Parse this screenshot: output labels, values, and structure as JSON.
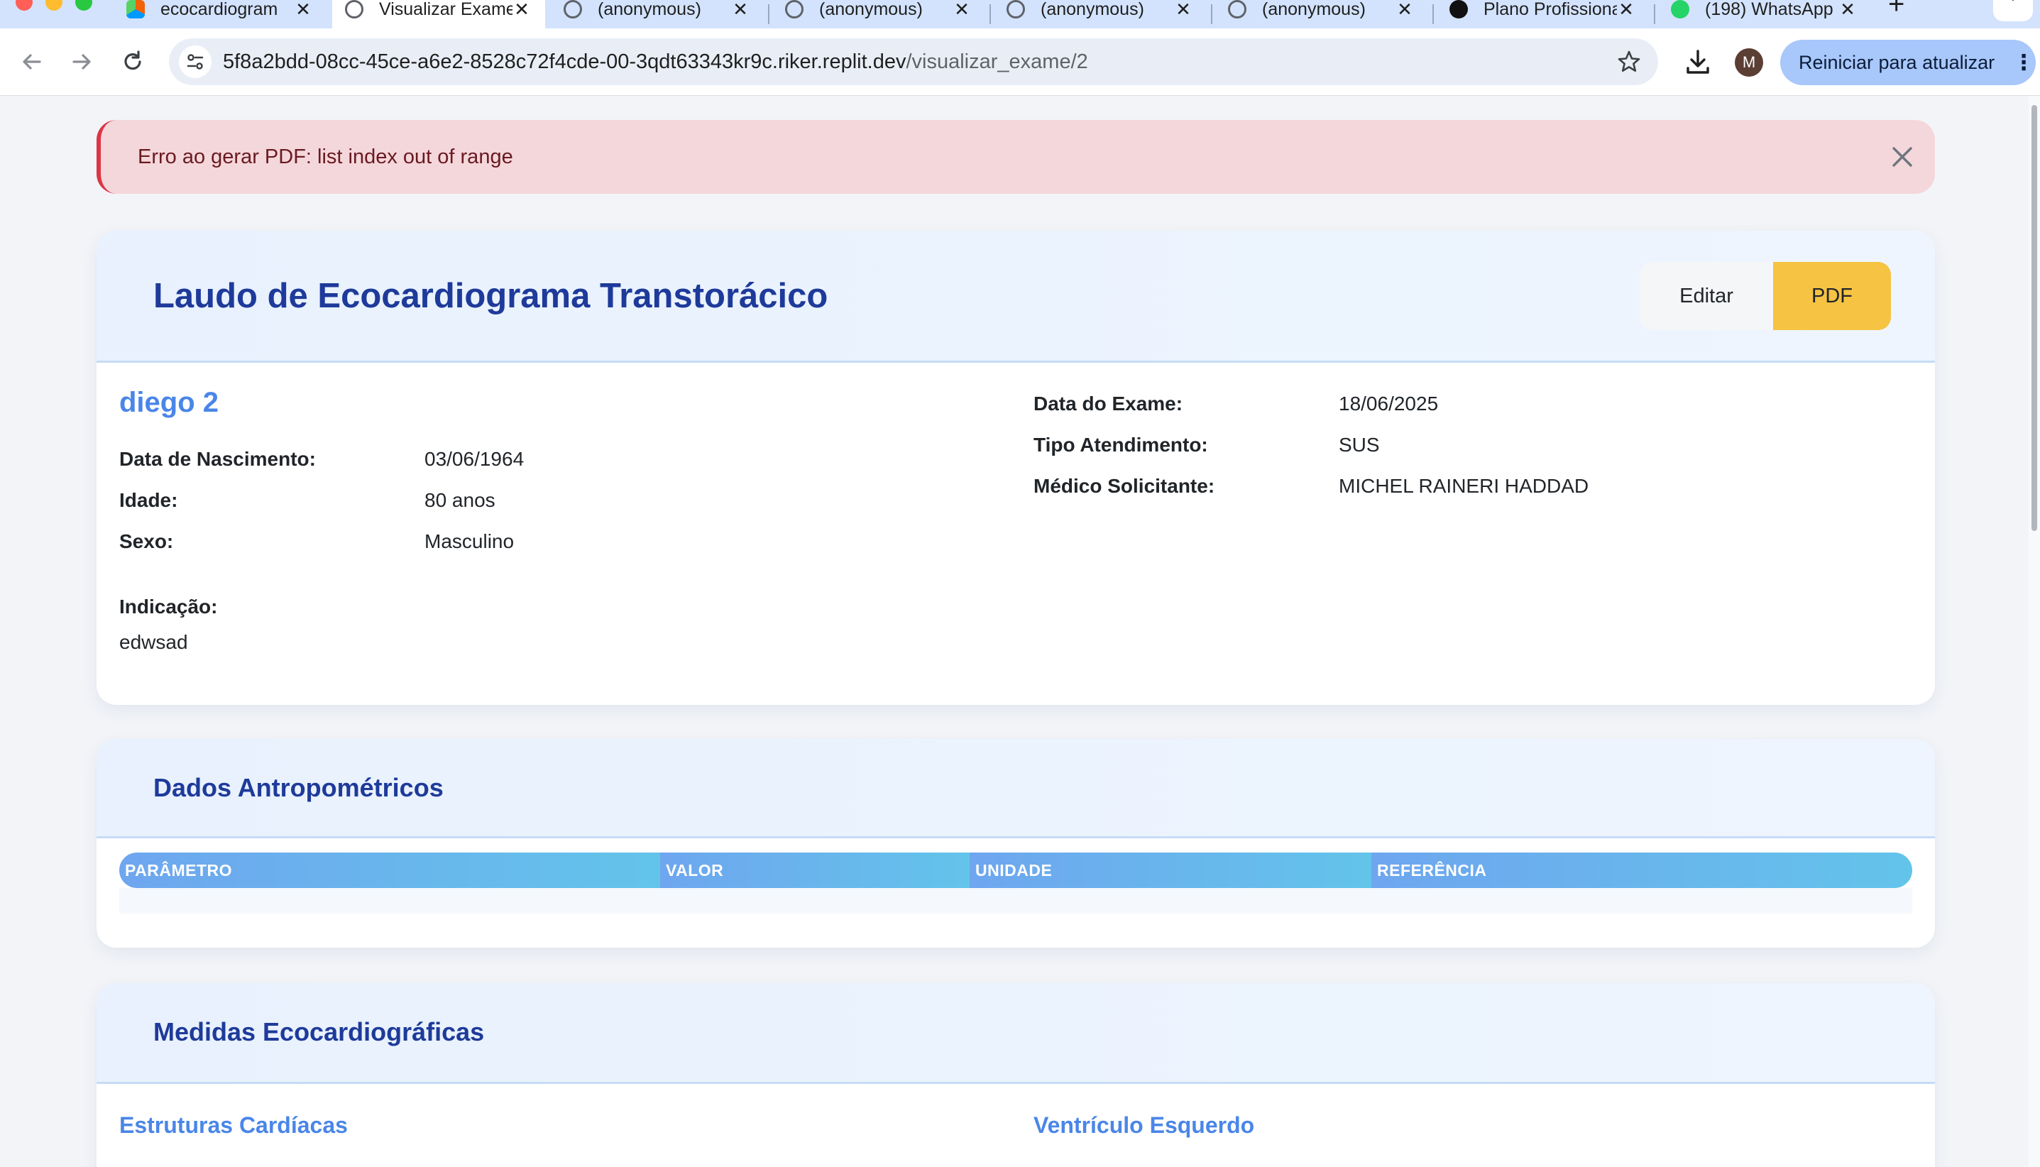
{
  "browser": {
    "tabs": [
      {
        "title": "ecocardiogram",
        "active": false
      },
      {
        "title": "Visualizar Exame",
        "active": true
      },
      {
        "title": "(anonymous)",
        "active": false
      },
      {
        "title": "(anonymous)",
        "active": false
      },
      {
        "title": "(anonymous)",
        "active": false
      },
      {
        "title": "(anonymous)",
        "active": false
      },
      {
        "title": "Plano Profissional",
        "active": false
      },
      {
        "title": "(198) WhatsApp",
        "active": false
      }
    ],
    "new_tab_symbol": "+",
    "url_host": "5f8a2bdd-08cc-45ce-a6e2-8528c72f4cde-00-3qdt63343kr9c.riker.replit.dev",
    "url_path": "/visualizar_exame/2",
    "profile_initial": "M",
    "update_button": "Reiniciar para atualizar"
  },
  "alert": {
    "message": "Erro ao gerar PDF: list index out of range"
  },
  "report": {
    "title": "Laudo de Ecocardiograma Transtorácico",
    "edit_label": "Editar",
    "pdf_label": "PDF",
    "patient_name": "diego 2",
    "birth_label": "Data de Nascimento:",
    "birth_value": "03/06/1964",
    "age_label": "Idade:",
    "age_value": "80 anos",
    "sex_label": "Sexo:",
    "sex_value": "Masculino",
    "indication_label": "Indicação:",
    "indication_value": "edwsad",
    "exam_date_label": "Data do Exame:",
    "exam_date_value": "18/06/2025",
    "service_label": "Tipo Atendimento:",
    "service_value": "SUS",
    "doctor_label": "Médico Solicitante:",
    "doctor_value": "MICHEL RAINERI HADDAD"
  },
  "anthropometric": {
    "title": "Dados Antropométricos",
    "columns": [
      "PARÂMETRO",
      "VALOR",
      "UNIDADE",
      "REFERÊNCIA"
    ]
  },
  "echo": {
    "title": "Medidas Ecocardiográficas",
    "left_subtitle": "Estruturas Cardíacas",
    "right_subtitle": "Ventrículo Esquerdo"
  },
  "colors": {
    "accent": "#4a86e8",
    "title": "#1e3a9a",
    "alert_bg": "#f4d7db",
    "pdf_button": "#f6c343"
  }
}
